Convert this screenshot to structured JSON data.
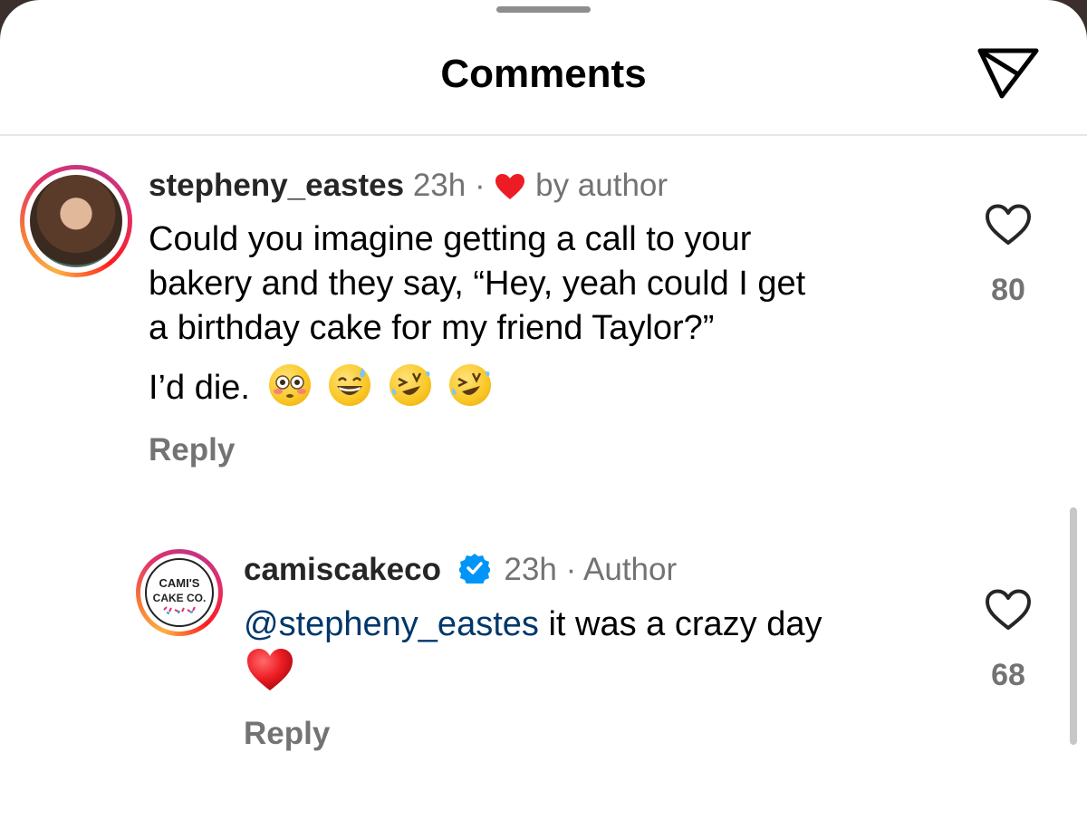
{
  "header": {
    "title": "Comments"
  },
  "comments": [
    {
      "username": "stepheny_eastes",
      "time": "23h",
      "separator": "·",
      "liked_by": "by author",
      "lines": [
        "Could you imagine getting a call to your",
        "bakery and they say, “Hey, yeah could I get",
        "a birthday cake for my friend Taylor?”"
      ],
      "last_line": "I’d die.",
      "emojis": [
        "flushed-face",
        "grinning-sweat-face",
        "rolling-laughing-face",
        "rolling-laughing-face"
      ],
      "reply_label": "Reply",
      "like_count": "80"
    },
    {
      "username": "camiscakeco",
      "time": "23h",
      "separator": "·",
      "role": "Author",
      "mention": "@stepheny_eastes",
      "text": " it was a crazy day",
      "reply_label": "Reply",
      "like_count": "68",
      "logo_line1": "CAMI'S",
      "logo_line2": "CAKE CO."
    }
  ],
  "colors": {
    "heart_red": "#ed1c24",
    "mention_blue": "#00376b",
    "verified_blue": "#0095f6",
    "muted_gray": "#737373"
  }
}
